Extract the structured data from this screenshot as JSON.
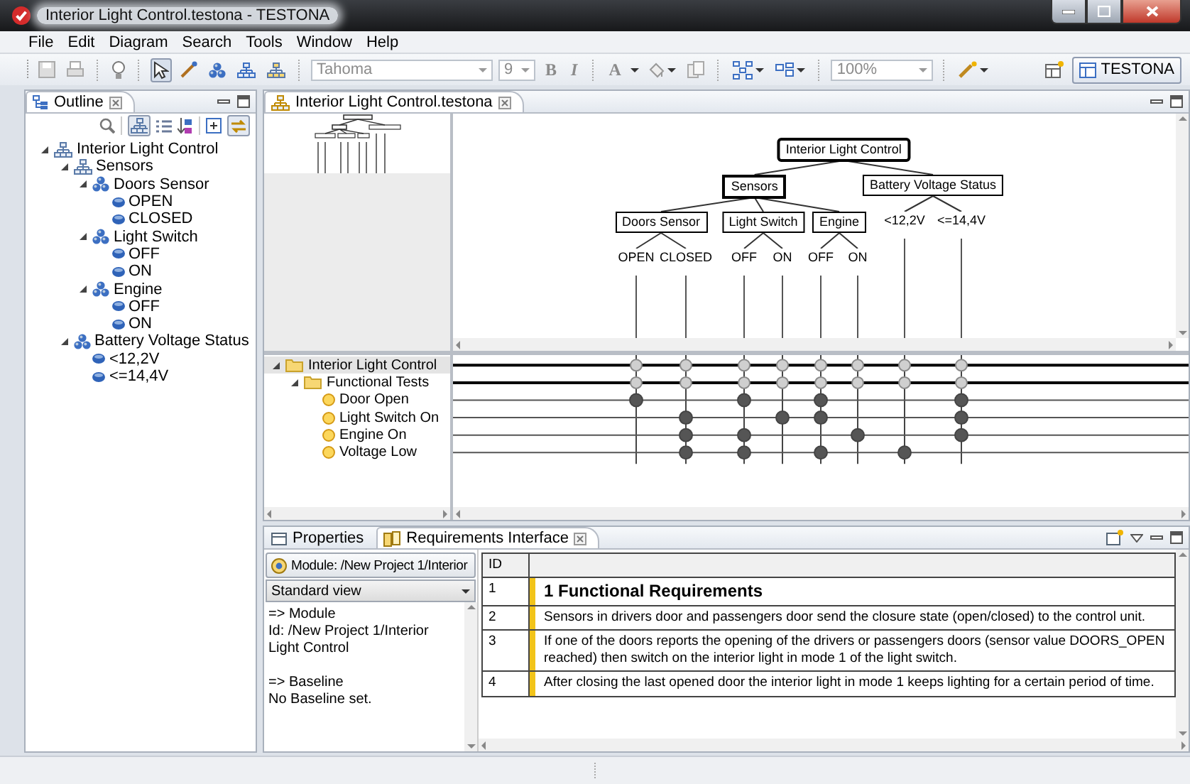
{
  "window": {
    "title": "Interior Light Control.testona - TESTONA"
  },
  "menu": [
    "File",
    "Edit",
    "Diagram",
    "Search",
    "Tools",
    "Window",
    "Help"
  ],
  "toolbar": {
    "pointer_tool": {
      "selected": true
    },
    "font_field": {
      "value": "Tahoma",
      "disabled": true
    },
    "size_field": {
      "value": "9",
      "disabled": true
    },
    "bold": {
      "label": "B",
      "disabled": true
    },
    "italic": {
      "label": "I",
      "disabled": true
    },
    "font_color": {
      "label": "A",
      "disabled": true
    },
    "zoom_field": {
      "value": "100%",
      "disabled": true
    },
    "perspective": {
      "label": "TESTONA",
      "selected": true
    }
  },
  "outline": {
    "tab": "Outline",
    "hierarchy_toggle": {
      "selected": true
    },
    "link_toggle": {
      "selected": true
    },
    "tree": [
      {
        "label": "Interior Light Control",
        "kind": "root",
        "expanded": true,
        "children": [
          {
            "label": "Sensors",
            "kind": "composition",
            "expanded": true,
            "children": [
              {
                "label": "Doors Sensor",
                "kind": "classification",
                "expanded": true,
                "children": [
                  {
                    "label": "OPEN",
                    "kind": "class"
                  },
                  {
                    "label": "CLOSED",
                    "kind": "class"
                  }
                ]
              },
              {
                "label": "Light Switch",
                "kind": "classification",
                "expanded": true,
                "children": [
                  {
                    "label": "OFF",
                    "kind": "class"
                  },
                  {
                    "label": "ON",
                    "kind": "class"
                  }
                ]
              },
              {
                "label": "Engine",
                "kind": "classification",
                "expanded": true,
                "children": [
                  {
                    "label": "OFF",
                    "kind": "class"
                  },
                  {
                    "label": "ON",
                    "kind": "class"
                  }
                ]
              }
            ]
          },
          {
            "label": "Battery Voltage Status",
            "kind": "classification",
            "expanded": true,
            "children": [
              {
                "label": "<12,2V",
                "kind": "class"
              },
              {
                "label": "<=14,4V",
                "kind": "class"
              }
            ]
          }
        ]
      }
    ]
  },
  "editor": {
    "tab": "Interior Light Control.testona",
    "diagram": {
      "label": "Interior Light Control",
      "kind": "root",
      "children": [
        {
          "label": "Sensors",
          "kind": "composition",
          "children": [
            {
              "label": "Doors Sensor",
              "kind": "classification",
              "children": [
                {
                  "label": "OPEN",
                  "kind": "class"
                },
                {
                  "label": "CLOSED",
                  "kind": "class"
                }
              ]
            },
            {
              "label": "Light Switch",
              "kind": "classification",
              "children": [
                {
                  "label": "OFF",
                  "kind": "class"
                },
                {
                  "label": "ON",
                  "kind": "class"
                }
              ]
            },
            {
              "label": "Engine",
              "kind": "classification",
              "children": [
                {
                  "label": "OFF",
                  "kind": "class"
                },
                {
                  "label": "ON",
                  "kind": "class"
                }
              ]
            }
          ]
        },
        {
          "label": "Battery Voltage Status",
          "kind": "classification",
          "children": [
            {
              "label": "<12,2V",
              "kind": "class"
            },
            {
              "label": "<=14,4V",
              "kind": "class"
            }
          ]
        }
      ]
    },
    "test_tree": [
      {
        "label": "Interior Light Control",
        "kind": "folder",
        "expanded": true,
        "selected": true,
        "children": [
          {
            "label": "Functional Tests",
            "kind": "folder",
            "expanded": true,
            "selected": false,
            "children": [
              {
                "label": "Door Open",
                "kind": "test",
                "selected": false,
                "marks": [
                  true,
                  false,
                  true,
                  false,
                  true,
                  false,
                  false,
                  true
                ]
              },
              {
                "label": "Light Switch On",
                "kind": "test",
                "selected": false,
                "marks": [
                  false,
                  true,
                  false,
                  true,
                  true,
                  false,
                  false,
                  true
                ]
              },
              {
                "label": "Engine On",
                "kind": "test",
                "selected": false,
                "marks": [
                  false,
                  true,
                  true,
                  false,
                  false,
                  true,
                  false,
                  true
                ]
              },
              {
                "label": "Voltage Low",
                "kind": "test",
                "selected": false,
                "marks": [
                  false,
                  true,
                  true,
                  false,
                  true,
                  false,
                  true,
                  false
                ]
              }
            ]
          }
        ]
      }
    ]
  },
  "bottom_panel": {
    "tabs": [
      {
        "label": "Properties",
        "selected": false
      },
      {
        "label": "Requirements Interface",
        "selected": true
      }
    ],
    "module_button": "Module: /New Project 1/Interior",
    "view_select": "Standard view",
    "info": [
      {
        "heading": "=> Module",
        "text": "Id: /New Project 1/Interior Light Control"
      },
      {
        "heading": "=> Baseline",
        "text": "No Baseline set."
      }
    ],
    "requirements": {
      "columns": [
        "ID"
      ],
      "rows": [
        {
          "id": "1",
          "kind": "heading",
          "text": "1 Functional Requirements"
        },
        {
          "id": "2",
          "kind": "text",
          "text": "Sensors in drivers door and passengers door send the closure state (open/closed) to the control unit."
        },
        {
          "id": "3",
          "kind": "text",
          "text": "If one of the doors reports the opening of the drivers or passengers doors (sensor value DOORS_OPEN reached) then switch on the interior light in mode 1 of the light switch."
        },
        {
          "id": "4",
          "kind": "text",
          "text": "After closing the last opened door the interior light in mode 1 keeps lighting for a certain period of time."
        }
      ]
    }
  }
}
